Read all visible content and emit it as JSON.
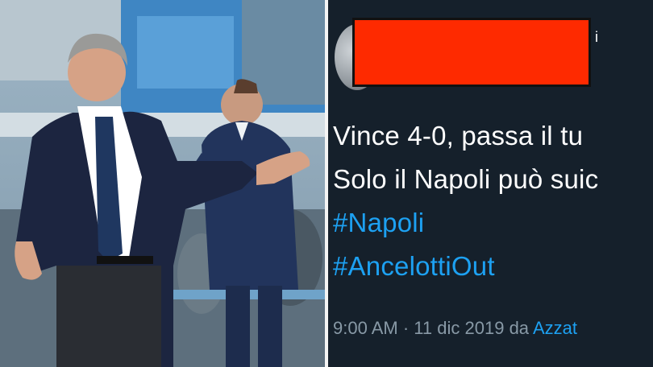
{
  "tweet": {
    "name_tail": "i",
    "lines": [
      "Vince 4-0, passa il tu",
      "Solo il Napoli può suic"
    ],
    "hashtags": [
      "#Napoli",
      "#AncelottiOut"
    ],
    "time": "9:00 AM",
    "separator": "·",
    "date": "11 dic 2019",
    "via": "da",
    "source": "Azzat"
  },
  "colors": {
    "tweet_bg": "#15202b",
    "hashtag": "#1da1f2",
    "meta": "#8899a6",
    "redaction": "#fe2a00"
  }
}
